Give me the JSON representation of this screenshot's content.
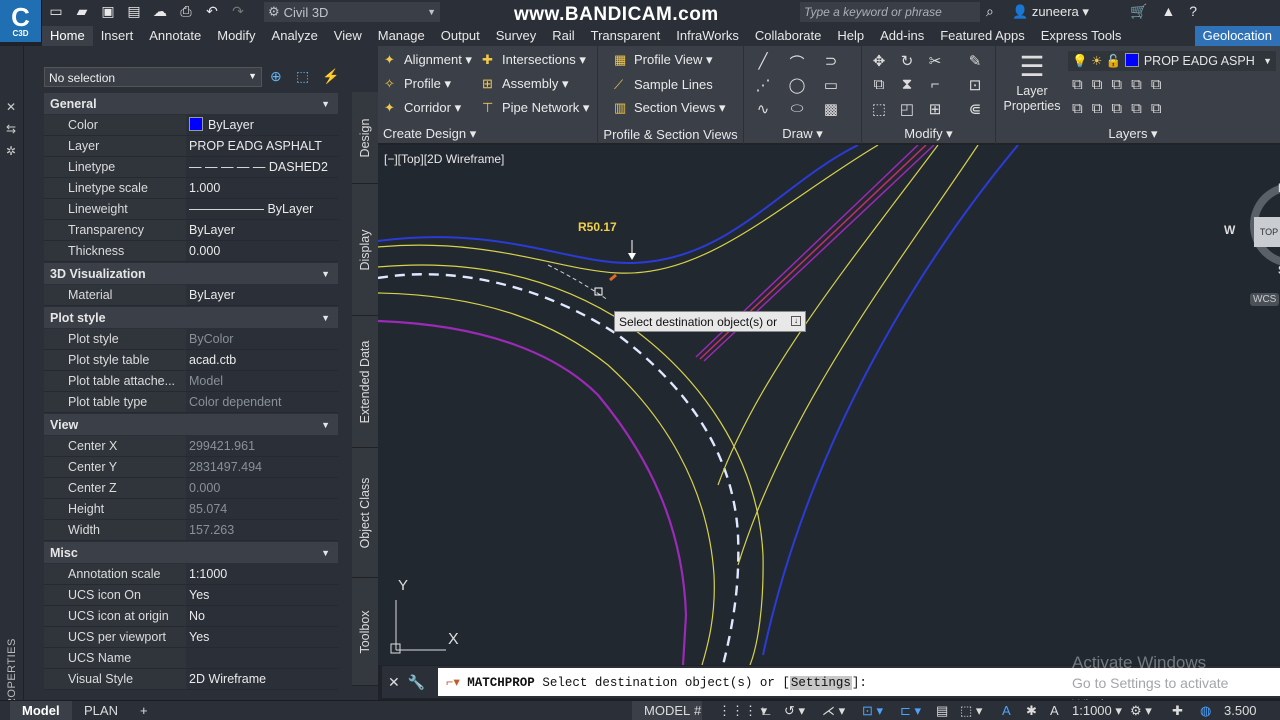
{
  "app": {
    "logo_text": "C",
    "logo_sub": "C3D",
    "workspace": "Civil 3D",
    "watermark": "www.BANDICAM.com",
    "search_placeholder": "Type a keyword or phrase",
    "user": "zuneera"
  },
  "menu": [
    "Home",
    "Insert",
    "Annotate",
    "Modify",
    "Analyze",
    "View",
    "Manage",
    "Output",
    "Survey",
    "Rail",
    "Transparent",
    "InfraWorks",
    "Collaborate",
    "Help",
    "Add-ins",
    "Featured Apps",
    "Express Tools",
    "Geolocation"
  ],
  "ribbon": {
    "create_design": {
      "title": "Create Design ▾",
      "items": [
        "Alignment ▾",
        "Profile ▾",
        "Corridor ▾",
        "Intersections ▾",
        "Assembly ▾",
        "Pipe Network ▾"
      ]
    },
    "profile_section": {
      "title": "Profile & Section Views",
      "items": [
        "Profile View ▾",
        "Sample Lines",
        "Section Views ▾"
      ]
    },
    "draw": {
      "title": "Draw ▾"
    },
    "modify": {
      "title": "Modify ▾"
    },
    "layers": {
      "title": "Layers ▾",
      "layer_props": "Layer Properties",
      "current_layer": "PROP EADG ASPH"
    }
  },
  "properties": {
    "selection": "No selection",
    "panel_label": "PROPERTIES",
    "side_tabs": [
      "Design",
      "Display",
      "Extended Data",
      "Object Class",
      "Toolbox"
    ],
    "categories": [
      {
        "name": "General",
        "rows": [
          {
            "n": "Color",
            "v": "ByLayer",
            "swatch": "#0000ff"
          },
          {
            "n": "Layer",
            "v": "PROP EADG ASPHALT"
          },
          {
            "n": "Linetype",
            "v": "— — — — —  DASHED2"
          },
          {
            "n": "Linetype scale",
            "v": "1.000"
          },
          {
            "n": "Lineweight",
            "v": "—————— ByLayer"
          },
          {
            "n": "Transparency",
            "v": "ByLayer"
          },
          {
            "n": "Thickness",
            "v": "0.000"
          }
        ]
      },
      {
        "name": "3D Visualization",
        "rows": [
          {
            "n": "Material",
            "v": "ByLayer"
          }
        ]
      },
      {
        "name": "Plot style",
        "rows": [
          {
            "n": "Plot style",
            "v": "ByColor",
            "dim": true
          },
          {
            "n": "Plot style table",
            "v": "acad.ctb"
          },
          {
            "n": "Plot table attache...",
            "v": "Model",
            "dim": true
          },
          {
            "n": "Plot table type",
            "v": "Color dependent",
            "dim": true
          }
        ]
      },
      {
        "name": "View",
        "rows": [
          {
            "n": "Center X",
            "v": "299421.961",
            "dim": true
          },
          {
            "n": "Center Y",
            "v": "2831497.494",
            "dim": true
          },
          {
            "n": "Center Z",
            "v": "0.000",
            "dim": true
          },
          {
            "n": "Height",
            "v": "85.074",
            "dim": true
          },
          {
            "n": "Width",
            "v": "157.263",
            "dim": true
          }
        ]
      },
      {
        "name": "Misc",
        "rows": [
          {
            "n": "Annotation scale",
            "v": "1:1000"
          },
          {
            "n": "UCS icon On",
            "v": "Yes"
          },
          {
            "n": "UCS icon at origin",
            "v": "No"
          },
          {
            "n": "UCS per viewport",
            "v": "Yes"
          },
          {
            "n": "UCS Name",
            "v": ""
          },
          {
            "n": "Visual Style",
            "v": "2D Wireframe"
          }
        ]
      }
    ]
  },
  "viewport": {
    "label": "[−][Top][2D Wireframe]",
    "tooltip": "Select destination object(s) or",
    "radius": "R50.17",
    "compass": {
      "n": "N",
      "w": "W",
      "s": "S",
      "top": "TOP",
      "wcs": "WCS"
    },
    "ucs_x": "X",
    "ucs_y": "Y"
  },
  "command": {
    "cmd": "MATCHPROP",
    "text": "Select destination object(s) or [",
    "option": "Settings",
    "tail": "]:"
  },
  "activate": {
    "line1": "Activate Windows",
    "line2": "Go to Settings to activate Windows."
  },
  "status": {
    "tabs": [
      "Model",
      "PLAN"
    ],
    "mode": "MODEL",
    "scale": "1:1000 ▾",
    "value": "3.500"
  }
}
